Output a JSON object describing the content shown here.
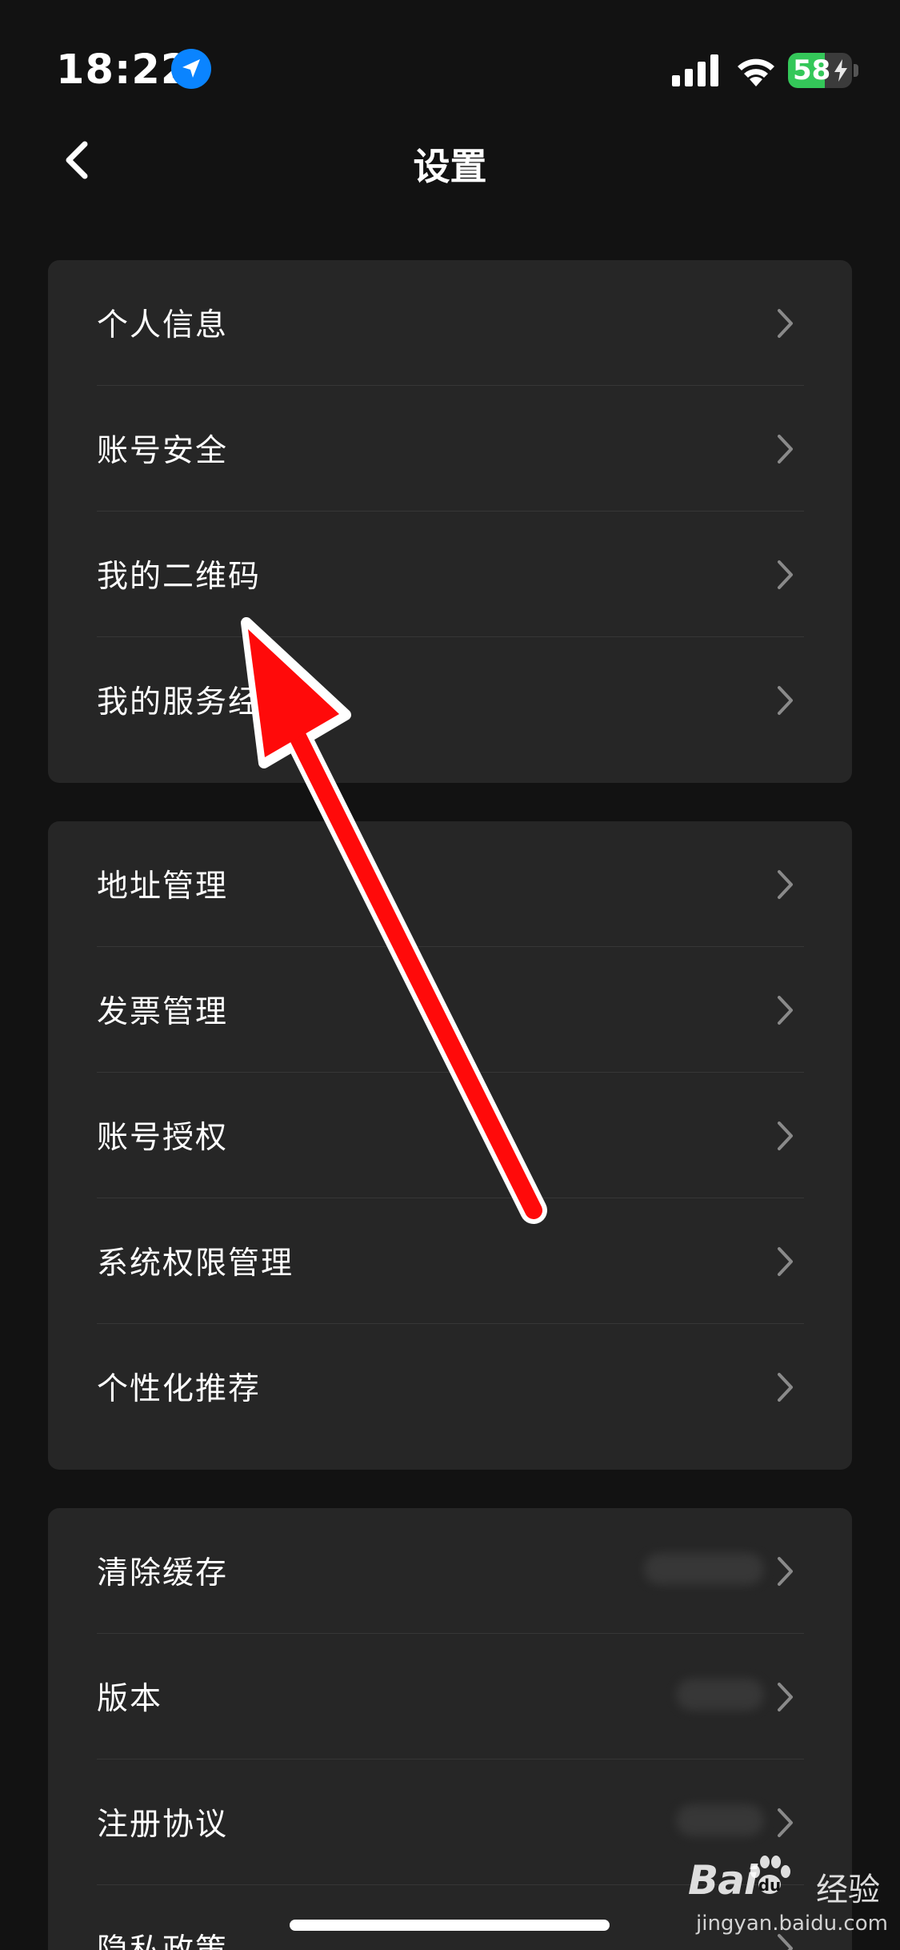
{
  "status_bar": {
    "time": "18:22",
    "battery_level": "58",
    "battery_fraction": 0.58,
    "icons": [
      "location-arrow-icon",
      "cellular-signal-icon",
      "wifi-icon",
      "battery-charging-icon"
    ]
  },
  "nav": {
    "title": "设置",
    "back_icon": "chevron-left-icon"
  },
  "groups": [
    {
      "items": [
        {
          "label": "个人信息"
        },
        {
          "label": "账号安全"
        },
        {
          "label": "我的二维码"
        },
        {
          "label": "我的服务经理"
        }
      ]
    },
    {
      "items": [
        {
          "label": "地址管理"
        },
        {
          "label": "发票管理"
        },
        {
          "label": "账号授权"
        },
        {
          "label": "系统权限管理"
        },
        {
          "label": "个性化推荐"
        }
      ]
    },
    {
      "items": [
        {
          "label": "清除缓存"
        },
        {
          "label": "版本"
        },
        {
          "label": "注册协议"
        },
        {
          "label": "隐私政策"
        }
      ]
    }
  ],
  "watermark": {
    "brand": "Bai",
    "brand_suffix": "经验",
    "url": "jingyan.baidu.com"
  },
  "colors": {
    "background": "#121212",
    "card": "#262626",
    "annotation_arrow": "#ff0000",
    "battery_green": "#34c759",
    "location_blue": "#0a84ff"
  }
}
